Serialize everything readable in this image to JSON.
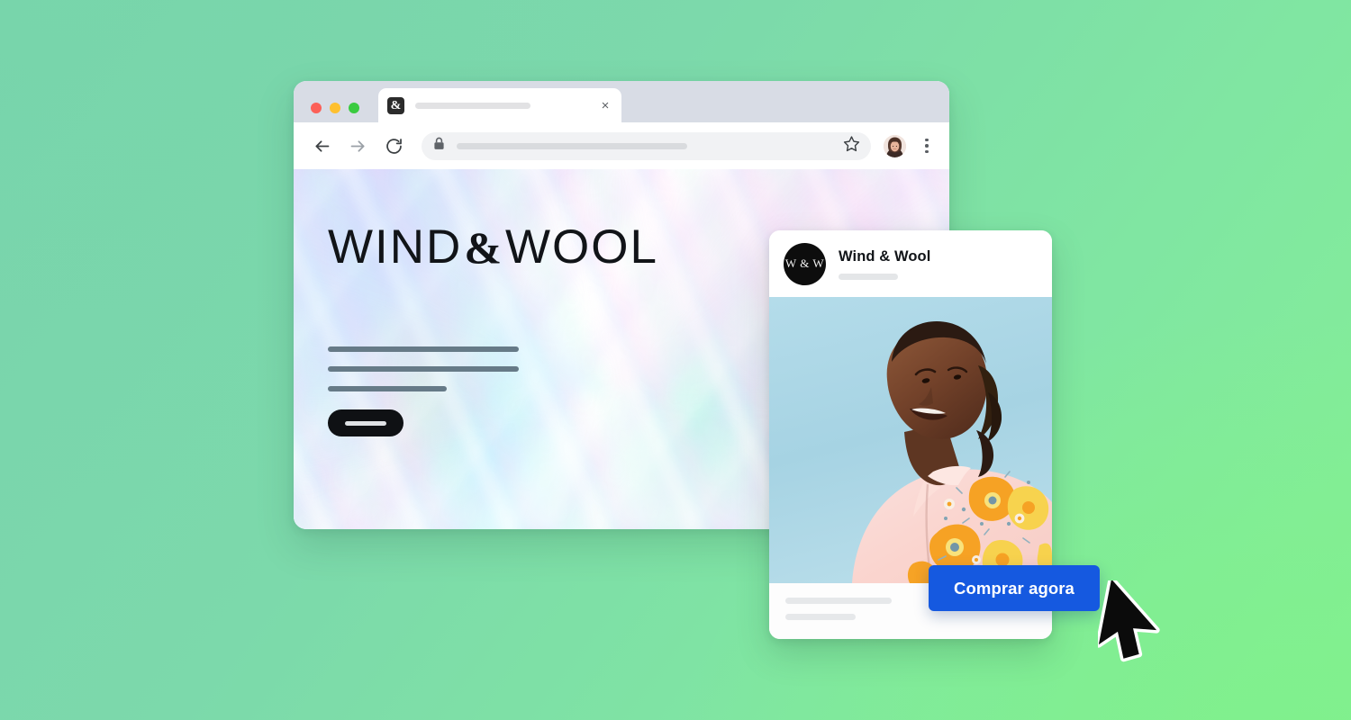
{
  "background": {
    "color_start": "#79d3ad",
    "color_end": "#84f095"
  },
  "browser": {
    "window_controls": [
      {
        "name": "close",
        "color": "#fc6058"
      },
      {
        "name": "minimize",
        "color": "#fec02f"
      },
      {
        "name": "maximize",
        "color": "#3acb40"
      }
    ],
    "tab": {
      "favicon_glyph": "&",
      "title": "",
      "close_glyph": "×"
    },
    "toolbar": {
      "back_icon": "arrow-left-icon",
      "forward_icon": "arrow-right-icon",
      "reload_icon": "reload-icon",
      "lock_icon": "lock-icon",
      "url_value": "",
      "url_placeholder": "",
      "bookmark_icon": "star-icon",
      "profile_icon": "avatar",
      "menu_icon": "kebab-menu-icon"
    },
    "page": {
      "wordmark_part1": "WIND",
      "wordmark_amp": "&",
      "wordmark_part2": "WOOL",
      "placeholder_lines": 3,
      "cta_label": ""
    }
  },
  "post_card": {
    "avatar_text": "W & W",
    "brand_name": "Wind & Wool",
    "handle_placeholder": "",
    "photo_alt": "woman in floral shirt looking up at blue sky",
    "caption_lines": 2
  },
  "cta": {
    "label": "Comprar agora",
    "color": "#1559e0",
    "text_color": "#ffffff"
  },
  "cursor": {
    "icon": "arrow-pointer-icon"
  }
}
